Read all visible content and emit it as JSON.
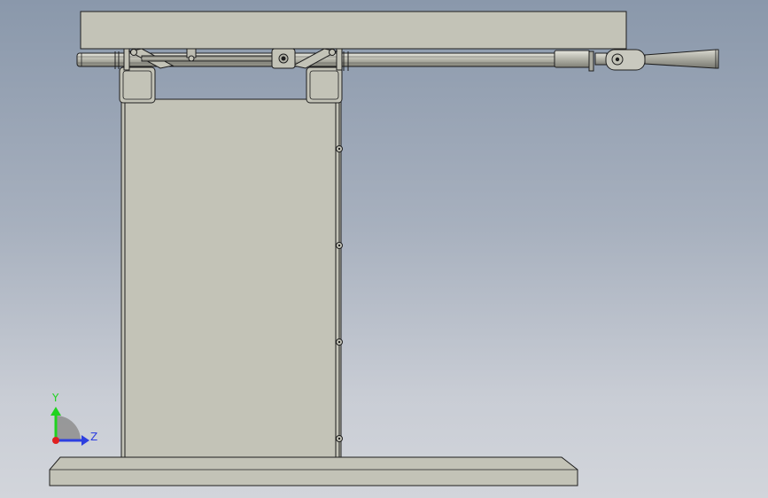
{
  "viewport": {
    "background_top": "#8a98ab",
    "background_bottom": "#d2d5db"
  },
  "model": {
    "parts": [
      "top-plate",
      "slide-rod",
      "rod-end-clevis",
      "cone-nozzle",
      "linkage-arms",
      "mounting-brackets",
      "column-body",
      "base-plate"
    ],
    "body_color": "#c3c3b7",
    "edge_color": "#1e1e1e"
  },
  "triad": {
    "y_label": "Y",
    "z_label": "Z",
    "y_color": "#1fd31f",
    "z_color": "#2d3fe0",
    "x_color": "#e02020"
  }
}
